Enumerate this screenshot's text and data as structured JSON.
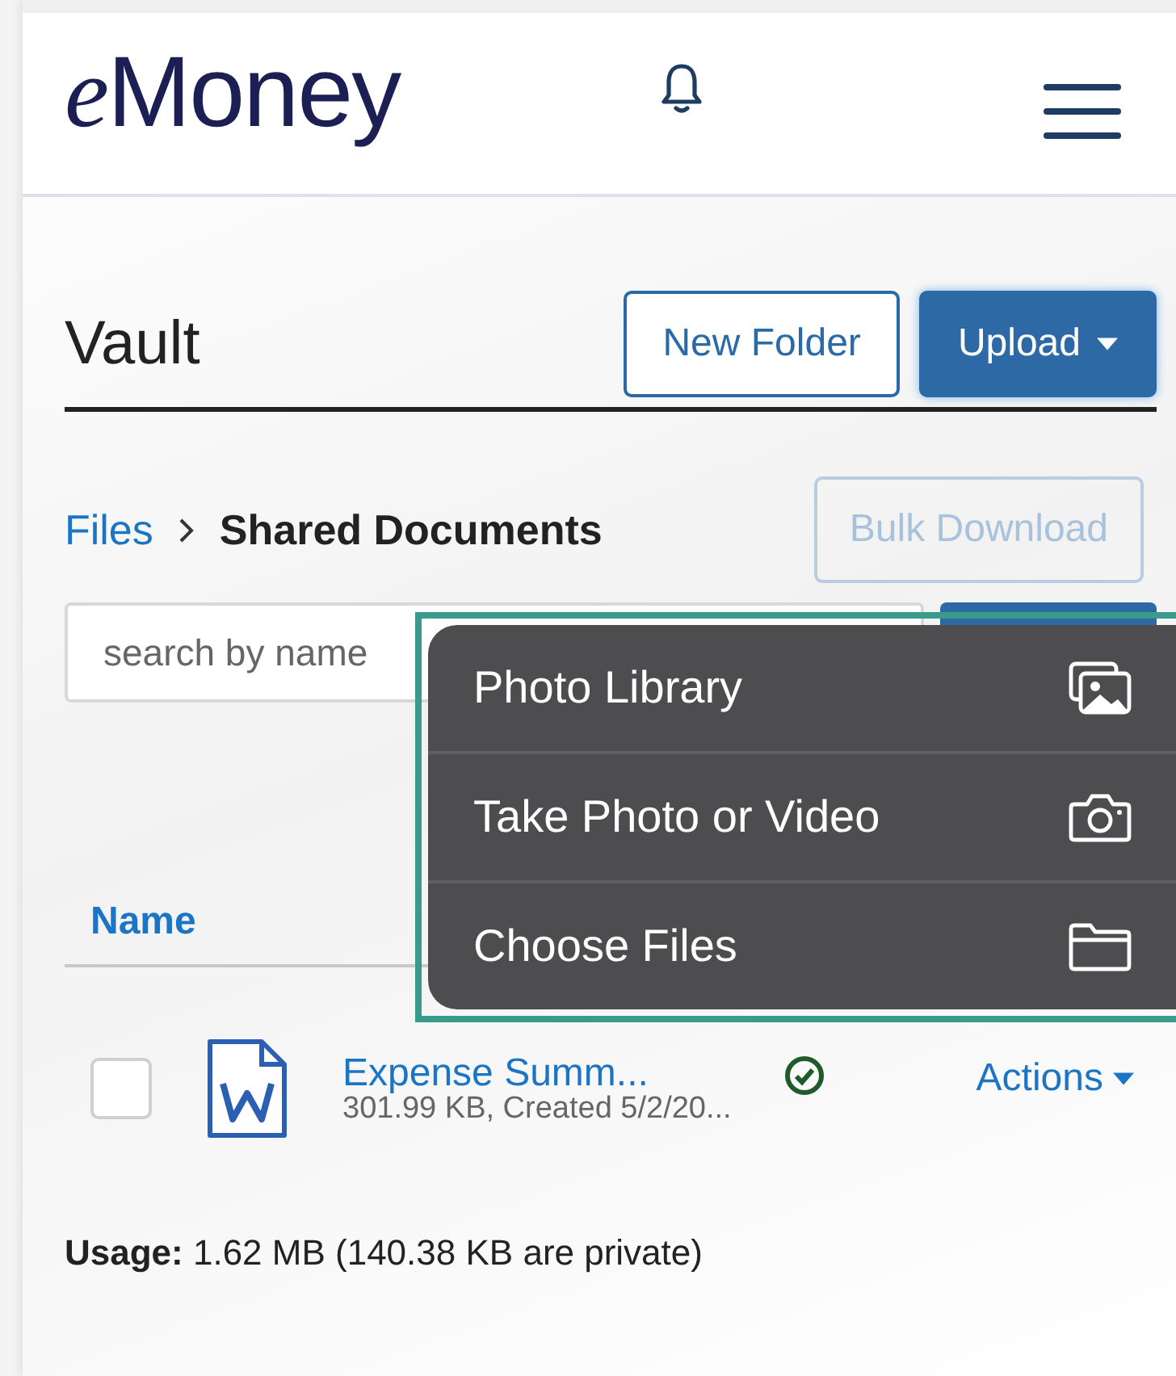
{
  "header": {
    "logo": "eMoney"
  },
  "vault": {
    "title": "Vault",
    "buttons": [
      {
        "label": "New Folder",
        "kind": "outline"
      },
      {
        "label": "Upload",
        "kind": "primary"
      }
    ]
  },
  "breadcrumb": [
    {
      "label": "Files",
      "selected": false
    },
    {
      "label": "Shared Documents",
      "selected": true
    }
  ],
  "bulk_download": {
    "label": "Bulk Download",
    "disabled": true
  },
  "search": {
    "placeholder": "search by name"
  },
  "table": {
    "columns": [
      "Name"
    ],
    "rows": [
      {
        "checked": false,
        "name": "Expense Summ...",
        "meta": "301.99 KB, Created 5/2/20...",
        "synced": true,
        "actions": "Actions"
      }
    ]
  },
  "usage": "**Usage:** 1.62 MB (140.38 KB are private)",
  "upload_menu": [
    {
      "label": "Photo Library",
      "kind": "photos"
    },
    {
      "label": "Take Photo or Video",
      "kind": "camera"
    },
    {
      "label": "Choose Files",
      "kind": "folder"
    }
  ]
}
